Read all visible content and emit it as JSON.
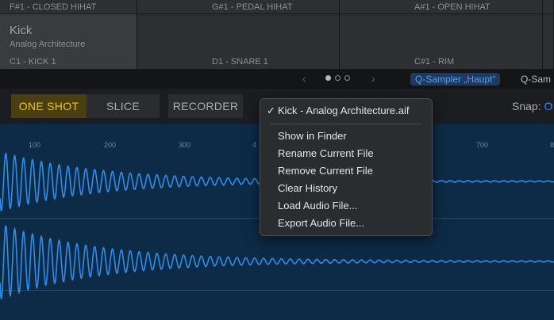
{
  "pads": {
    "row1": [
      "F#1 - CLOSED HIHAT",
      "G#1 - PEDAL HIHAT",
      "A#1 - OPEN HIHAT"
    ],
    "selected": {
      "title": "Kick",
      "subtitle": "Analog Architecture",
      "note": "C1 - KICK 1"
    },
    "row2": [
      "D1 - SNARE 1",
      "C#1 - RIM"
    ]
  },
  "nav": {
    "prev_arrow": "‹",
    "next_arrow": "›",
    "instrument_pill": "Q-Sampler „Haupt“",
    "instrument_text": "Q-Sam"
  },
  "toolbar": {
    "one_shot": "ONE SHOT",
    "slice": "SLICE",
    "recorder": "RECORDER",
    "snap_label": "Snap:",
    "snap_value": "O"
  },
  "ruler": {
    "ticks": [
      "100",
      "200",
      "300",
      "4",
      "700",
      "8"
    ]
  },
  "menu": {
    "current_file": "Kick  - Analog Architecture.aif",
    "check_mark": "✓",
    "items": [
      "Show in Finder",
      "Rename Current File",
      "Remove Current File",
      "Clear History",
      "Load Audio File...",
      "Export Audio File..."
    ]
  },
  "colors": {
    "waveform": "#2f8de8",
    "wave_background": "#0d2b47",
    "active_mode": "#e6c22c",
    "accent": "#2e8cff"
  }
}
